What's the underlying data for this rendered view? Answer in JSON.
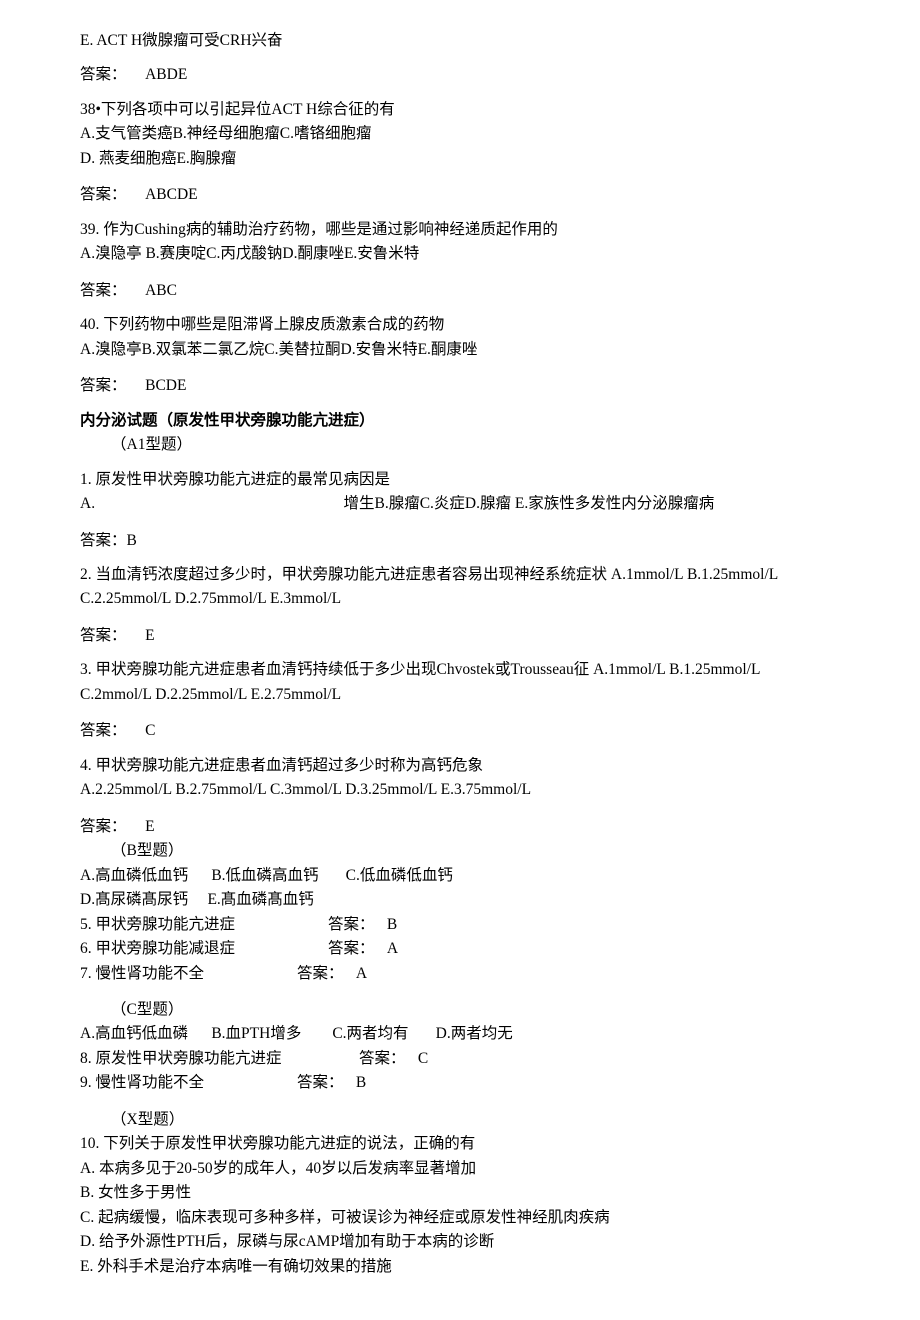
{
  "top_line": "E.  ACT H微腺瘤可受CRH兴奋",
  "ans_label": "答案：",
  "ans_label2": "答案:",
  "ans37": "ABDE",
  "q38": {
    "stem": "38•下列各项中可以引起异位ACT H综合征的有",
    "opts1": "A.支气管类癌B.神经母细胞瘤C.嗜铬细胞瘤",
    "opts2": "D.    燕麦细胞癌E.胸腺瘤",
    "ans": "ABCDE"
  },
  "q39": {
    "stem": "39.  作为Cushing病的辅助治疗药物，哪些是通过影响神经递质起作用的",
    "opts": "A.溴隐亭  B.赛庚啶C.丙戊酸钠D.酮康唑E.安鲁米特",
    "ans": "ABC"
  },
  "q40": {
    "stem": "40.  下列药物中哪些是阻滞肾上腺皮质激素合成的药物",
    "opts": "A.溴隐亭B.双氯苯二氯乙烷C.美替拉酮D.安鲁米特E.酮康唑",
    "ans": "BCDE"
  },
  "section": "内分泌试题（原发性甲状旁腺功能亢进症）",
  "typeA1": "（A1型题）",
  "q1": {
    "stem": "1.  原发性甲状旁腺功能亢进症的最常见病因是",
    "opts_a": "A.",
    "opts_rest": "增生B.腺瘤C.炎症D.腺瘤 E.家族性多发性内分泌腺瘤病",
    "ans": "B"
  },
  "q2": {
    "stem1": "2.  当血清钙浓度超过多少时，甲状旁腺功能亢进症患者容易出现神经系统症状  A.1mmol/L B.1.25mmol/L",
    "stem2": "C.2.25mmol/L D.2.75mmol/L E.3mmol/L",
    "ans": "E"
  },
  "q3": {
    "stem1": "3.  甲状旁腺功能亢进症患者血清钙持续低于多少出现Chvostek或Trousseau征  A.1mmol/L B.1.25mmol/L",
    "stem2": "C.2mmol/L D.2.25mmol/L E.2.75mmol/L",
    "ans": "C"
  },
  "q4": {
    "stem": "4.  甲状旁腺功能亢进症患者血清钙超过多少时称为高钙危象",
    "opts": "A.2.25mmol/L B.2.75mmol/L C.3mmol/L D.3.25mmol/L E.3.75mmol/L",
    "ans": "E"
  },
  "typeB": "（B型题）",
  "b_opts1": "A.高血磷低血钙      B.低血磷高血钙       C.低血磷低血钙",
  "b_opts2": "D.髙尿磷髙尿钙     E.髙血磷髙血钙",
  "b_q5": "5.  甲状旁腺功能亢进症",
  "b_q5_ans": "B",
  "b_q6": "6.  甲状旁腺功能减退症",
  "b_q6_ans": "A",
  "b_q7": "7.  慢性肾功能不全",
  "b_q7_ans": "A",
  "typeC": "（C型题）",
  "c_opts": "A.高血钙低血磷      B.血PTH增多        C.两者均有       D.两者均无",
  "c_q8": "8.  原发性甲状旁腺功能亢进症",
  "c_q8_ans": "C",
  "c_q9": "9.  慢性肾功能不全",
  "c_q9_ans": "B",
  "typeX": "（X型题）",
  "q10": {
    "stem": "10.  下列关于原发性甲状旁腺功能亢进症的说法，正确的有",
    "a": "A.  本病多见于20-50岁的成年人，40岁以后发病率显著增加",
    "b": "B.  女性多于男性",
    "c": "C.  起病缓慢，临床表现可多种多样，可被误诊为神经症或原发性神经肌肉疾病",
    "d": "D.  给予外源性PTH后，尿磷与尿cAMP增加有助于本病的诊断",
    "e": "E.  外科手术是治疗本病唯一有确切效果的措施"
  }
}
